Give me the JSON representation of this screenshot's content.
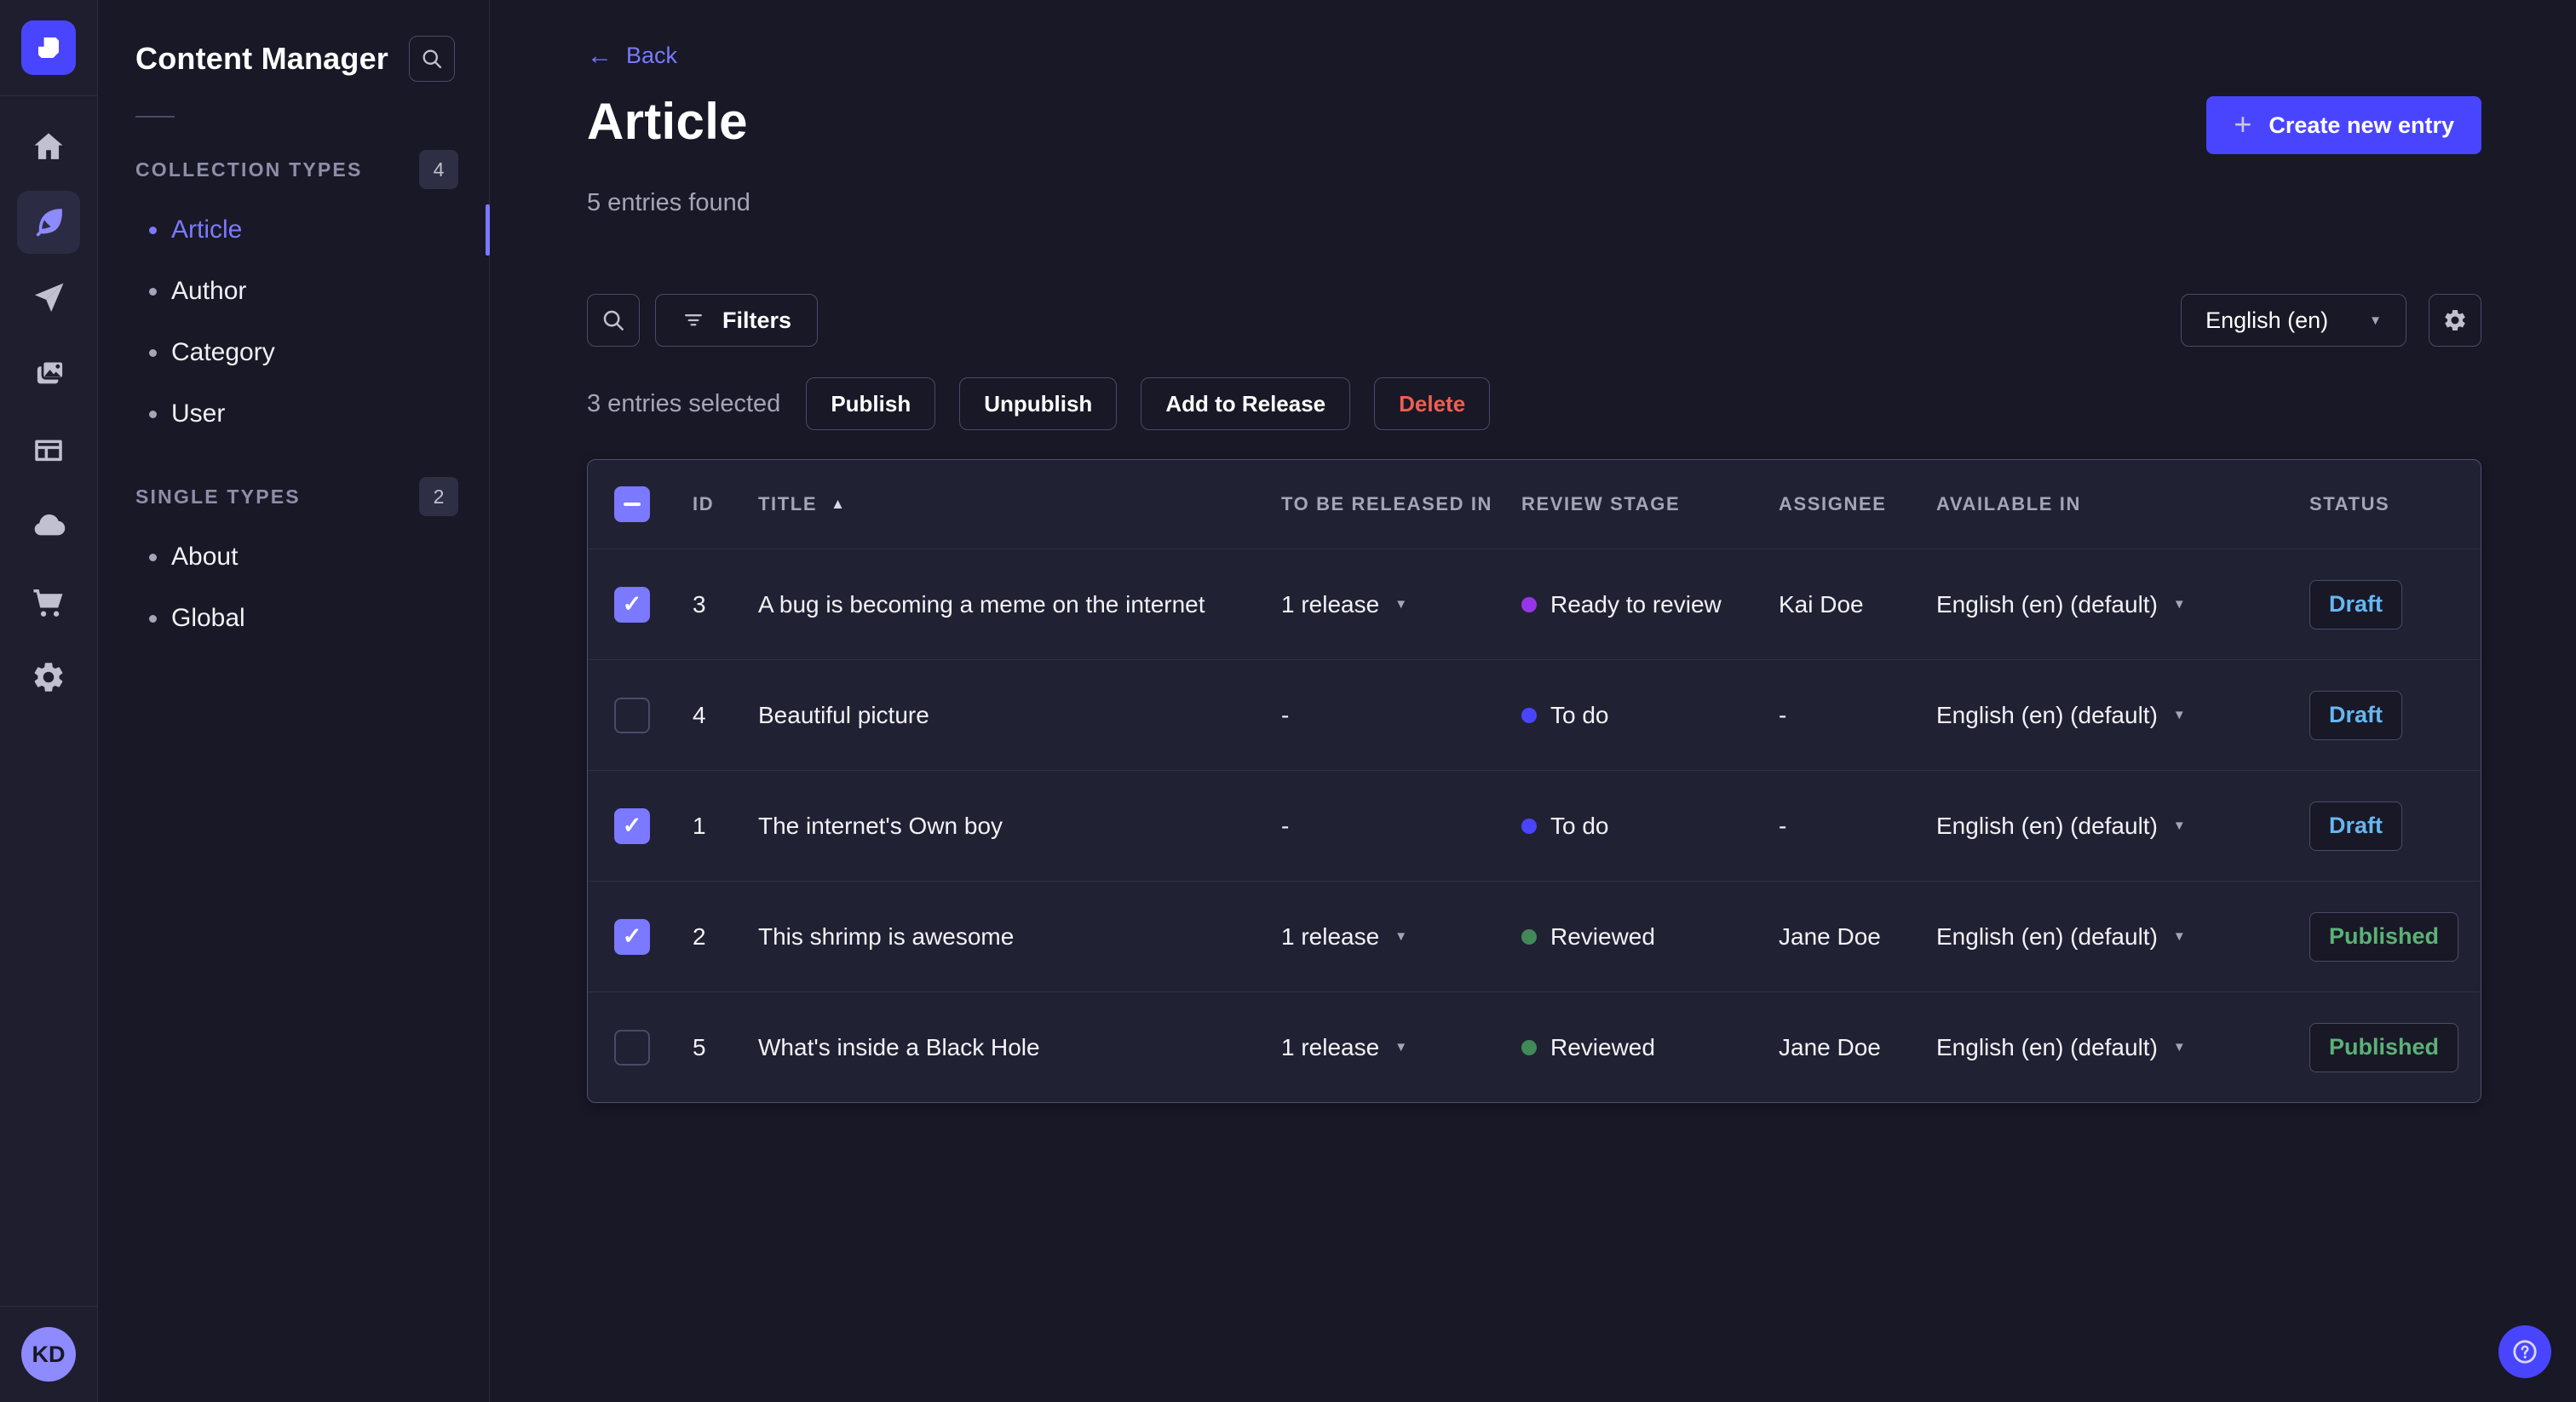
{
  "colors": {
    "primary": "#4945FF",
    "primary_light": "#7B79FF",
    "page_bg": "#181826",
    "panel_bg": "#212134",
    "rail_bg": "#1E1E2F",
    "border": "#2E2E44",
    "border_control": "#4A4A6A",
    "text_muted": "#A5A5BA",
    "danger_text": "#EE5E52",
    "draft_text": "#66B7F1",
    "published_text": "#5CB176",
    "stage_ready_to_review": "#9736E8",
    "stage_to_do": "#4945FF",
    "stage_reviewed": "#418958",
    "avatar_bg": "#8E8AFF"
  },
  "rail": {
    "icons": [
      "strapi-logo",
      "home-icon",
      "content-manager-feather-icon",
      "send-icon",
      "media-library-icon",
      "content-type-builder-icon",
      "cloud-icon",
      "marketplace-cart-icon",
      "settings-gear-icon"
    ],
    "active_icon": "content-manager-feather-icon",
    "avatar_initials": "KD"
  },
  "subnav": {
    "title": "Content Manager",
    "search_icon": "search-icon",
    "sections": [
      {
        "label": "COLLECTION TYPES",
        "count": "4",
        "items": [
          {
            "label": "Article",
            "active": true
          },
          {
            "label": "Author"
          },
          {
            "label": "Category"
          },
          {
            "label": "User"
          }
        ]
      },
      {
        "label": "SINGLE TYPES",
        "count": "2",
        "items": [
          {
            "label": "About"
          },
          {
            "label": "Global"
          }
        ]
      }
    ]
  },
  "header": {
    "back_label": "Back",
    "title": "Article",
    "subtitle": "5 entries found",
    "create_button_label": "Create new entry"
  },
  "toolbar": {
    "filters_label": "Filters",
    "locale_value": "English (en)"
  },
  "bulk": {
    "selected_text": "3 entries selected",
    "publish_label": "Publish",
    "unpublish_label": "Unpublish",
    "add_to_release_label": "Add to Release",
    "delete_label": "Delete"
  },
  "table": {
    "headers": {
      "id": "ID",
      "title": "TITLE",
      "release": "TO BE RELEASED IN",
      "stage": "REVIEW STAGE",
      "assignee": "ASSIGNEE",
      "available": "AVAILABLE IN",
      "status": "STATUS"
    },
    "sort": {
      "column": "TITLE",
      "direction": "ascending"
    },
    "header_checkbox_state": "indeterminate",
    "rows": [
      {
        "selected": true,
        "id": "3",
        "title": "A bug is becoming a meme on the internet",
        "release": "1 release",
        "release_caret": true,
        "stage": "Ready to review",
        "stage_color": "#9736E8",
        "assignee": "Kai Doe",
        "available": "English (en) (default)",
        "status": "Draft"
      },
      {
        "selected": false,
        "id": "4",
        "title": "Beautiful picture",
        "release": "-",
        "release_caret": false,
        "stage": "To do",
        "stage_color": "#4945FF",
        "assignee": "-",
        "available": "English (en) (default)",
        "status": "Draft"
      },
      {
        "selected": true,
        "id": "1",
        "title": "The internet's Own boy",
        "release": "-",
        "release_caret": false,
        "stage": "To do",
        "stage_color": "#4945FF",
        "assignee": "-",
        "available": "English (en) (default)",
        "status": "Draft"
      },
      {
        "selected": true,
        "id": "2",
        "title": "This shrimp is awesome",
        "release": "1 release",
        "release_caret": true,
        "stage": "Reviewed",
        "stage_color": "#418958",
        "assignee": "Jane Doe",
        "available": "English (en) (default)",
        "status": "Published"
      },
      {
        "selected": false,
        "id": "5",
        "title": "What's inside a Black Hole",
        "release": "1 release",
        "release_caret": true,
        "stage": "Reviewed",
        "stage_color": "#418958",
        "assignee": "Jane Doe",
        "available": "English (en) (default)",
        "status": "Published"
      }
    ]
  },
  "help": {
    "icon": "question-mark-icon"
  }
}
